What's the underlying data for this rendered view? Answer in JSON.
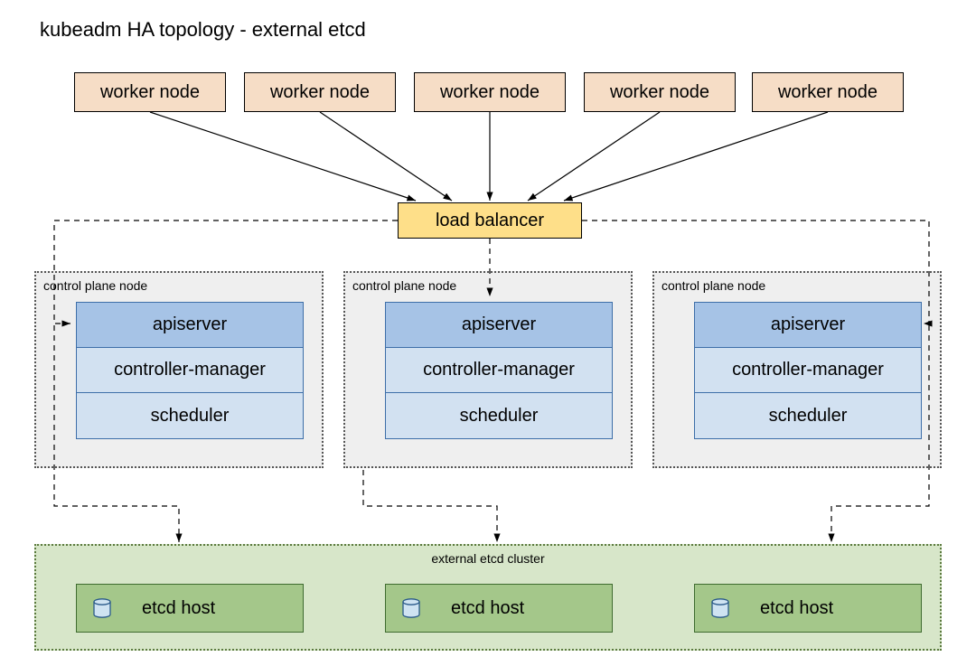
{
  "title": "kubeadm HA topology - external etcd",
  "workers": [
    {
      "label": "worker node"
    },
    {
      "label": "worker node"
    },
    {
      "label": "worker node"
    },
    {
      "label": "worker node"
    },
    {
      "label": "worker node"
    }
  ],
  "load_balancer": {
    "label": "load balancer"
  },
  "control_planes": [
    {
      "label": "control plane node",
      "rows": {
        "api": "apiserver",
        "cm": "controller-manager",
        "sch": "scheduler"
      }
    },
    {
      "label": "control plane node",
      "rows": {
        "api": "apiserver",
        "cm": "controller-manager",
        "sch": "scheduler"
      }
    },
    {
      "label": "control plane node",
      "rows": {
        "api": "apiserver",
        "cm": "controller-manager",
        "sch": "scheduler"
      }
    }
  ],
  "etcd_cluster": {
    "label": "external etcd cluster",
    "hosts": [
      {
        "label": "etcd host"
      },
      {
        "label": "etcd host"
      },
      {
        "label": "etcd host"
      }
    ]
  },
  "colors": {
    "worker_fill": "#f6ddc6",
    "lb_fill": "#fedf89",
    "cp_bg": "#efefef",
    "api_fill": "#a6c3e6",
    "cp_row_fill": "#d2e1f1",
    "etcd_bg": "#d7e6c9",
    "etcd_host_fill": "#a4c78a"
  }
}
